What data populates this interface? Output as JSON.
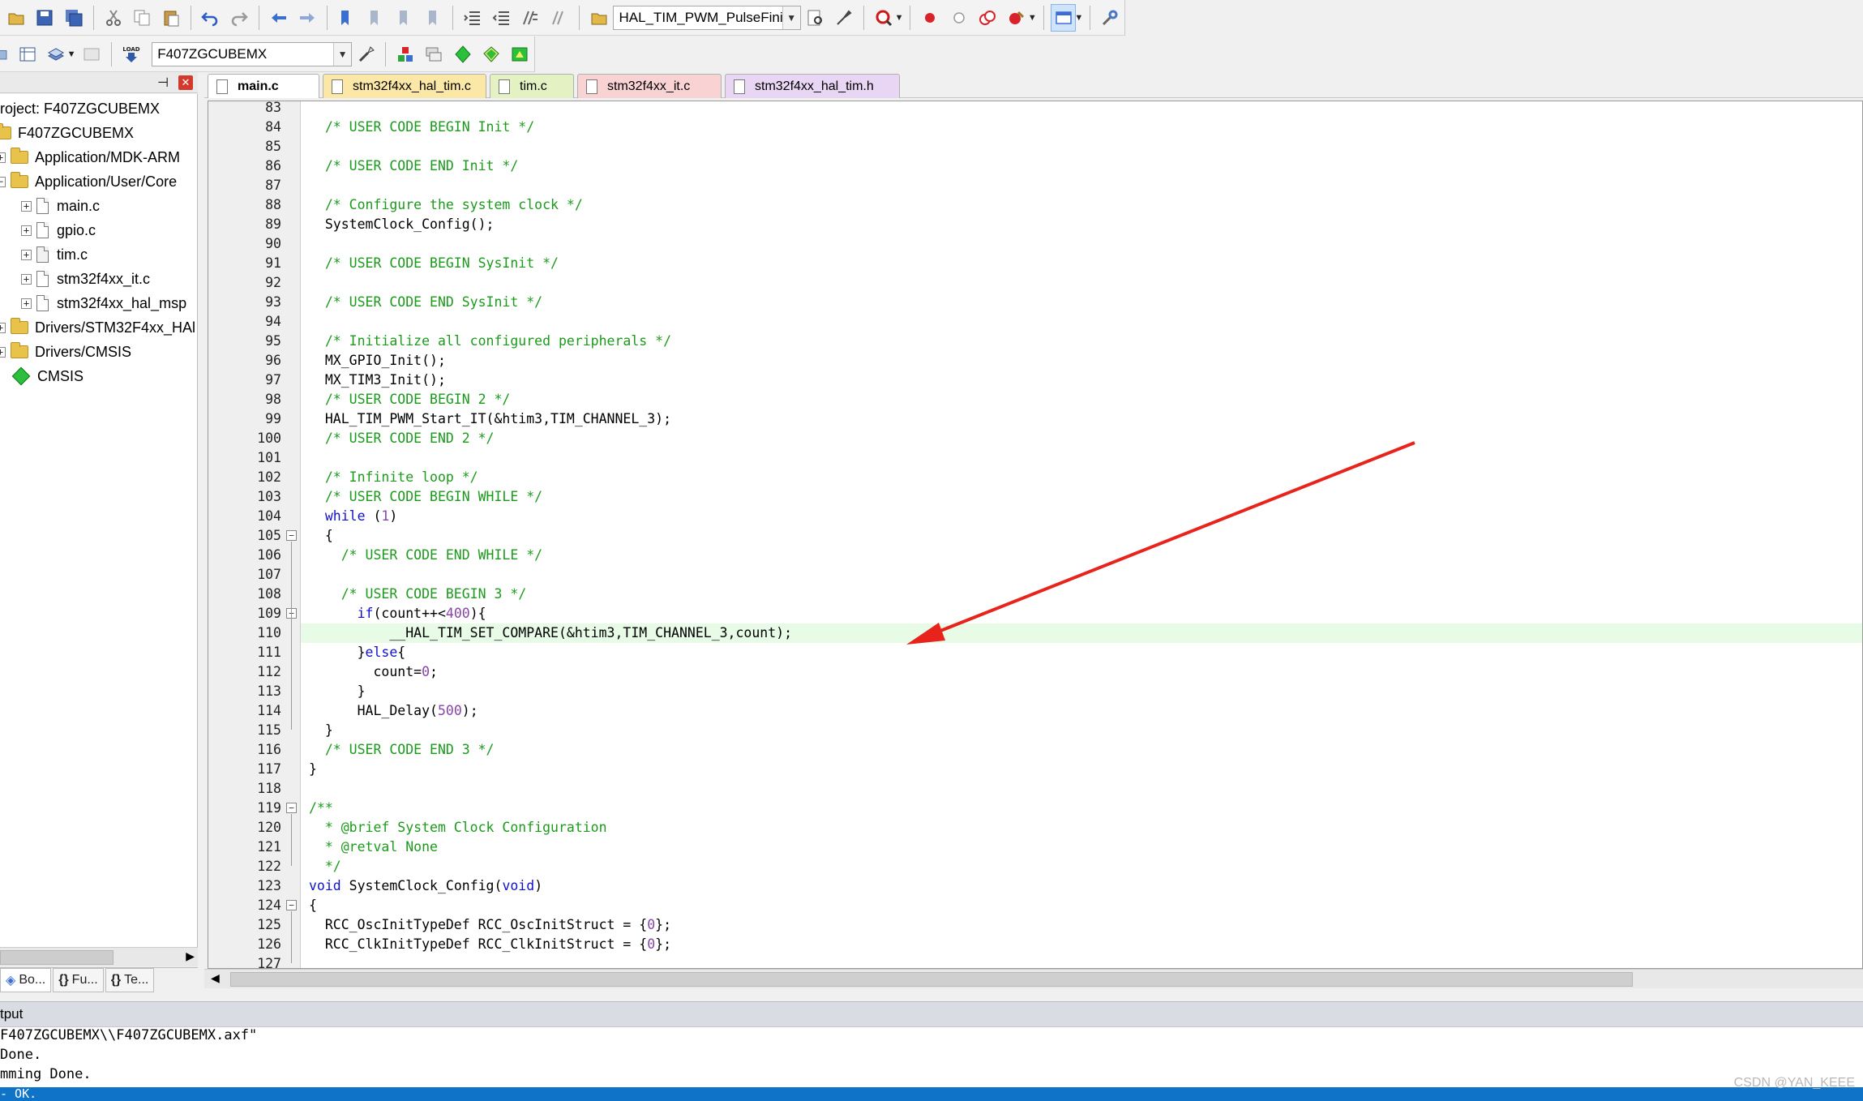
{
  "toolbar1": {
    "target_function_combo": "HAL_TIM_PWM_PulseFini"
  },
  "toolbar2": {
    "load_label": "LOAD",
    "target_combo": "F407ZGCUBEMX"
  },
  "project_panel": {
    "root_label": "roject: F407ZGCUBEMX",
    "target_label": "F407ZGCUBEMX",
    "items": [
      {
        "label": "Application/MDK-ARM"
      },
      {
        "label": "Application/User/Core"
      },
      {
        "label": "main.c"
      },
      {
        "label": "gpio.c"
      },
      {
        "label": "tim.c"
      },
      {
        "label": "stm32f4xx_it.c"
      },
      {
        "label": "stm32f4xx_hal_msp"
      },
      {
        "label": "Drivers/STM32F4xx_HAl"
      },
      {
        "label": "Drivers/CMSIS"
      },
      {
        "label": "CMSIS"
      }
    ],
    "tabs": [
      {
        "label": "Bo..."
      },
      {
        "label": "Fu..."
      },
      {
        "label": "Te..."
      }
    ]
  },
  "editor": {
    "tabs": [
      {
        "label": "main.c",
        "color": "#ffffff"
      },
      {
        "label": "stm32f4xx_hal_tim.c",
        "color": "#fbe7a6"
      },
      {
        "label": "tim.c",
        "color": "#e4f2c3"
      },
      {
        "label": "stm32f4xx_it.c",
        "color": "#f9d2d4"
      },
      {
        "label": "stm32f4xx_hal_tim.h",
        "color": "#e8d6f4"
      }
    ],
    "highlight_line": 110,
    "lines": [
      {
        "num": "83",
        "text": ""
      },
      {
        "num": "84",
        "text": "  /* USER CODE BEGIN Init */"
      },
      {
        "num": "85",
        "text": ""
      },
      {
        "num": "86",
        "text": "  /* USER CODE END Init */"
      },
      {
        "num": "87",
        "text": ""
      },
      {
        "num": "88",
        "text": "  /* Configure the system clock */"
      },
      {
        "num": "89",
        "text": "  SystemClock_Config();"
      },
      {
        "num": "90",
        "text": ""
      },
      {
        "num": "91",
        "text": "  /* USER CODE BEGIN SysInit */"
      },
      {
        "num": "92",
        "text": ""
      },
      {
        "num": "93",
        "text": "  /* USER CODE END SysInit */"
      },
      {
        "num": "94",
        "text": ""
      },
      {
        "num": "95",
        "text": "  /* Initialize all configured peripherals */"
      },
      {
        "num": "96",
        "text": "  MX_GPIO_Init();"
      },
      {
        "num": "97",
        "text": "  MX_TIM3_Init();"
      },
      {
        "num": "98",
        "text": "  /* USER CODE BEGIN 2 */"
      },
      {
        "num": "99",
        "text": "  HAL_TIM_PWM_Start_IT(&htim3,TIM_CHANNEL_3);"
      },
      {
        "num": "100",
        "text": "  /* USER CODE END 2 */"
      },
      {
        "num": "101",
        "text": ""
      },
      {
        "num": "102",
        "text": "  /* Infinite loop */"
      },
      {
        "num": "103",
        "text": "  /* USER CODE BEGIN WHILE */"
      },
      {
        "num": "104",
        "text": "  while (1)"
      },
      {
        "num": "105",
        "text": "  {"
      },
      {
        "num": "106",
        "text": "    /* USER CODE END WHILE */"
      },
      {
        "num": "107",
        "text": ""
      },
      {
        "num": "108",
        "text": "    /* USER CODE BEGIN 3 */"
      },
      {
        "num": "109",
        "text": "      if(count++<400){"
      },
      {
        "num": "110",
        "text": "          __HAL_TIM_SET_COMPARE(&htim3,TIM_CHANNEL_3,count);"
      },
      {
        "num": "111",
        "text": "      }else{"
      },
      {
        "num": "112",
        "text": "        count=0;"
      },
      {
        "num": "113",
        "text": "      }"
      },
      {
        "num": "114",
        "text": "      HAL_Delay(500);"
      },
      {
        "num": "115",
        "text": "  }"
      },
      {
        "num": "116",
        "text": "  /* USER CODE END 3 */"
      },
      {
        "num": "117",
        "text": "}"
      },
      {
        "num": "118",
        "text": ""
      },
      {
        "num": "119",
        "text": "/**"
      },
      {
        "num": "120",
        "text": "  * @brief System Clock Configuration"
      },
      {
        "num": "121",
        "text": "  * @retval None"
      },
      {
        "num": "122",
        "text": "  */"
      },
      {
        "num": "123",
        "text": "void SystemClock_Config(void)"
      },
      {
        "num": "124",
        "text": "{"
      },
      {
        "num": "125",
        "text": "  RCC_OscInitTypeDef RCC_OscInitStruct = {0};"
      },
      {
        "num": "126",
        "text": "  RCC_ClkInitTypeDef RCC_ClkInitStruct = {0};"
      },
      {
        "num": "127",
        "text": ""
      }
    ],
    "fold_lines": [
      "105",
      "109",
      "119",
      "124"
    ]
  },
  "output": {
    "title": "tput",
    "lines": [
      "F407ZGCUBEMX\\\\F407ZGCUBEMX.axf\"",
      "Done.",
      "mming Done."
    ],
    "status_text": "- OK."
  },
  "watermark": "CSDN @YAN_KEEE",
  "colors": {
    "comment": "#1c9a1c",
    "keyword": "#1111cc",
    "number": "#8844aa",
    "highlight_bg": "#e7fbe7",
    "status_bar": "#0f73c8",
    "annotation_arrow": "#e8231b"
  }
}
